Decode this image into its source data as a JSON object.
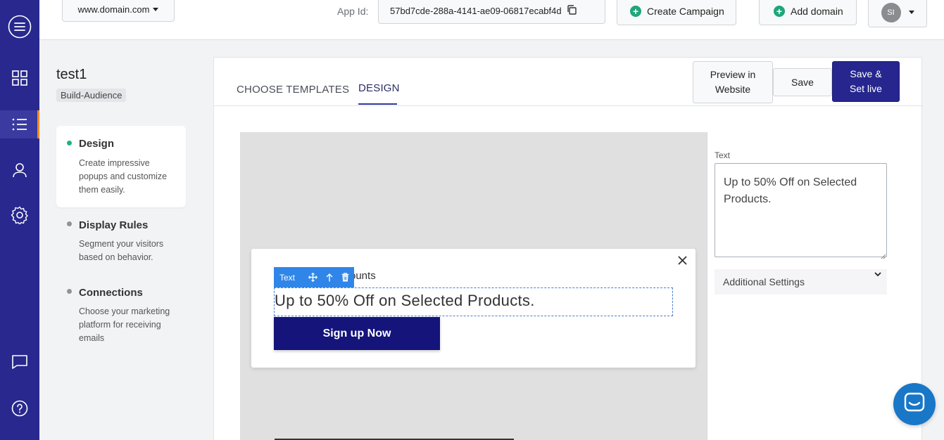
{
  "topbar": {
    "domain": "www.domain.com",
    "app_id_label": "App Id:",
    "app_id": "57bd7cde-288a-4141-ae09-06817ecabf4d",
    "create_campaign": "Create Campaign",
    "add_domain": "Add domain",
    "user_initials": "SI"
  },
  "campaign": {
    "name": "test1",
    "type_badge": "Build-Audience"
  },
  "steps": [
    {
      "title": "Design",
      "desc": "Create impressive popups and customize them easily.",
      "active": true
    },
    {
      "title": "Display Rules",
      "desc": "Segment your visitors based on behavior."
    },
    {
      "title": "Connections",
      "desc": "Choose your marketing platform for receiving emails"
    }
  ],
  "tabs": {
    "choose_templates": "CHOOSE TEMPLATES",
    "design": "DESIGN"
  },
  "actions": {
    "preview": "Preview in Website",
    "save": "Save",
    "save_live": "Save & Set live"
  },
  "popup": {
    "heading_partial": "ounts",
    "toolbar_label": "Text",
    "body_text": "Up to 50% Off on Selected Products.",
    "cta": "Sign up Now"
  },
  "settings": {
    "text_label": "Text",
    "text_value": "Up to 50% Off on Selected Products.",
    "additional": "Additional Settings"
  },
  "colors": {
    "nav": "#28288f",
    "primary": "#26268e",
    "cta": "#14147a",
    "accent_green": "#1fa67a",
    "toolbar_blue": "#2f86e8",
    "chat_blue": "#1977c8"
  }
}
